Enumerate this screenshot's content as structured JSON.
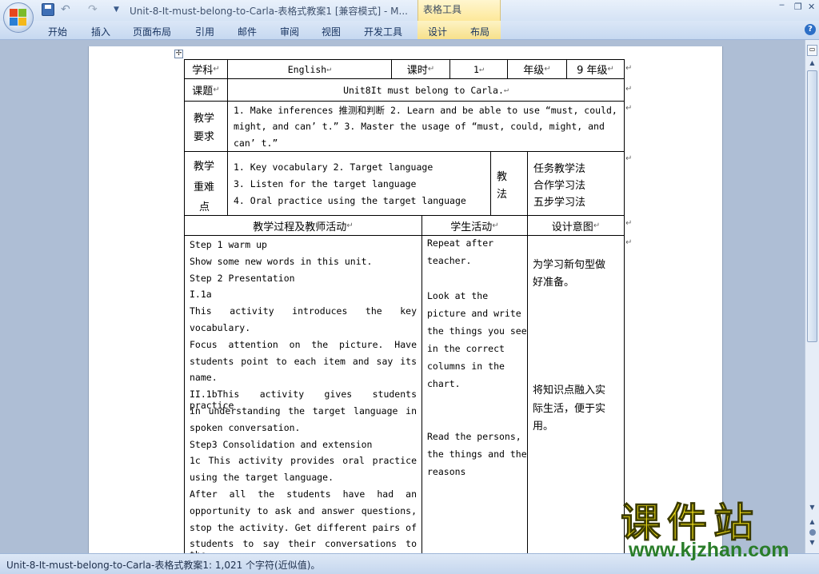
{
  "window": {
    "title": "Unit-8-It-must-belong-to-Carla-表格式教案1 [兼容模式] - M...",
    "context_tab_group": "表格工具",
    "controls": {
      "minimize": "‒",
      "restore": "❐",
      "close": "✕"
    }
  },
  "qat": {
    "undo_glyph": "↶",
    "redo_glyph": "↷",
    "dropdown_glyph": "▼"
  },
  "ribbon": {
    "tabs": [
      "开始",
      "插入",
      "页面布局",
      "引用",
      "邮件",
      "审阅",
      "视图",
      "开发工具",
      "设计",
      "布局"
    ],
    "help": "?"
  },
  "status_bar": {
    "text": "Unit-8-It-must-belong-to-Carla-表格式教案1: 1,021 个字符(近似值)。"
  },
  "scrollbar": {
    "up": "▲",
    "down": "▼",
    "prev": "▲",
    "next": "▼",
    "ruler": "▭"
  },
  "table": {
    "handle": "✢",
    "para_mark": "↵",
    "row1": {
      "subject_label": "学科",
      "subject_value": "English",
      "hours_label": "课时",
      "hours_value": "1",
      "grade_label": "年级",
      "grade_value": "9 年级"
    },
    "topic_label": "课题",
    "topic_value": "Unit8It must belong to Carla.",
    "goals_label_1": "教学",
    "goals_label_2": "要求",
    "goals_lines": [
      "1. Make inferences 推测和判断 2. Learn and be able to use  “must, could,",
      "might,  and  can’ t.” 3.  Master  the  usage  of  “must,  could,  might,  and",
      "can’ t.”"
    ],
    "keys_label": [
      "教学",
      "重难",
      "点"
    ],
    "keys_lines": [
      "1. Key vocabulary 2. Target language",
      "3. Listen for the target language",
      "4. Oral practice using the target language"
    ],
    "method_label": [
      "教",
      "法"
    ],
    "methods": [
      "任务教学法",
      "合作学习法",
      "五步学习法"
    ],
    "headers": {
      "process": "教学过程及教师活动",
      "student": "学生活动",
      "design": "设计意图"
    },
    "process_lines": [
      "Step 1 warm up",
      "Show some new words in this unit.",
      "Step 2  Presentation",
      "I.1a",
      "This activity introduces the key",
      "vocabulary.",
      "Focus attention on the picture. Have",
      "students point to each item and say its",
      "name.",
      "II.1bThis activity gives students practice",
      "in understanding the target language in",
      "spoken conversation.",
      "Step3 Consolidation and extension",
      "1c This activity provides oral practice",
      "using the target language.",
      "After all the students have had an",
      "opportunity to ask and answer questions,",
      "stop the activity. Get different pairs of",
      "students to say their conversations to the"
    ],
    "student_lines": [
      "Repeat after",
      "teacher.",
      "",
      "Look at the",
      "picture and write",
      "the things you see",
      "in the correct",
      "columns in the",
      "chart.",
      "",
      "",
      "Read the persons,",
      "the things and the",
      "reasons",
      "",
      ""
    ],
    "design_lines": [
      "",
      "为学习新句型做",
      "好准备。",
      "",
      "",
      "",
      "",
      "",
      "将知识点融入实",
      "际生活，便于实",
      "用。",
      "",
      "",
      "",
      ""
    ]
  },
  "watermark": {
    "title": "课件站",
    "url": "www.kjzhan.com"
  }
}
